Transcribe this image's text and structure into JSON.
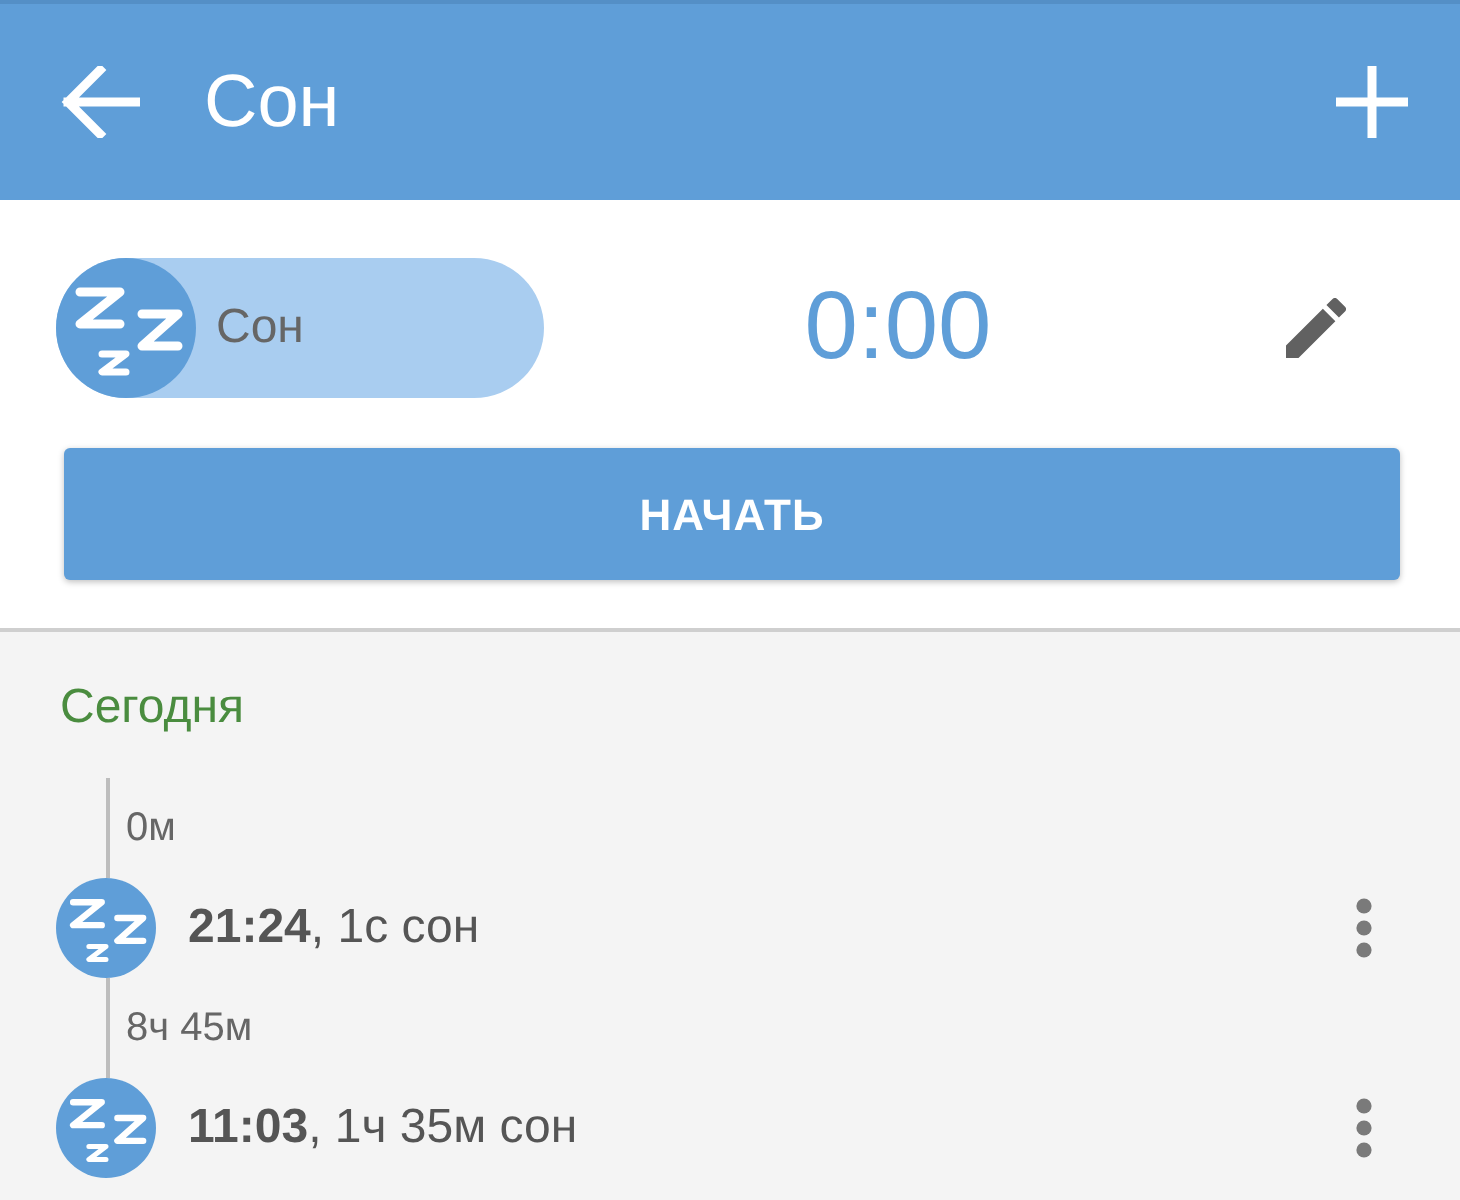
{
  "app_bar": {
    "title": "Сон"
  },
  "activity": {
    "label": "Сон",
    "timer": "0:00"
  },
  "start_button": {
    "label": "НАЧАТЬ"
  },
  "history": {
    "section_title": "Сегодня",
    "entries": [
      {
        "gap": "0м",
        "text": "**21:24**, 1с сон"
      },
      {
        "gap": "8ч 45м",
        "text": "**11:03**, 1ч 35м сон"
      }
    ]
  }
}
